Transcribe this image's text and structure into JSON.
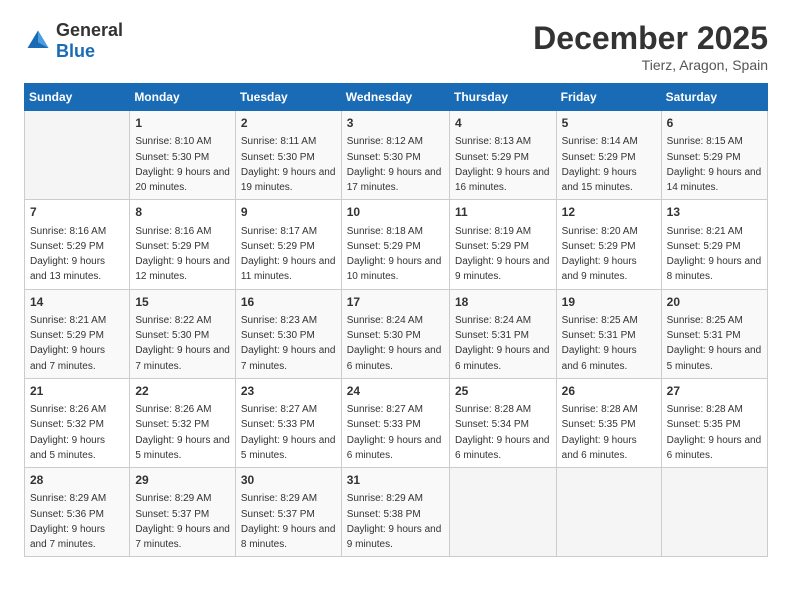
{
  "header": {
    "logo_general": "General",
    "logo_blue": "Blue",
    "month": "December 2025",
    "location": "Tierz, Aragon, Spain"
  },
  "weekdays": [
    "Sunday",
    "Monday",
    "Tuesday",
    "Wednesday",
    "Thursday",
    "Friday",
    "Saturday"
  ],
  "weeks": [
    [
      {
        "day": "",
        "sunrise": "",
        "sunset": "",
        "daylight": ""
      },
      {
        "day": "1",
        "sunrise": "Sunrise: 8:10 AM",
        "sunset": "Sunset: 5:30 PM",
        "daylight": "Daylight: 9 hours and 20 minutes."
      },
      {
        "day": "2",
        "sunrise": "Sunrise: 8:11 AM",
        "sunset": "Sunset: 5:30 PM",
        "daylight": "Daylight: 9 hours and 19 minutes."
      },
      {
        "day": "3",
        "sunrise": "Sunrise: 8:12 AM",
        "sunset": "Sunset: 5:30 PM",
        "daylight": "Daylight: 9 hours and 17 minutes."
      },
      {
        "day": "4",
        "sunrise": "Sunrise: 8:13 AM",
        "sunset": "Sunset: 5:29 PM",
        "daylight": "Daylight: 9 hours and 16 minutes."
      },
      {
        "day": "5",
        "sunrise": "Sunrise: 8:14 AM",
        "sunset": "Sunset: 5:29 PM",
        "daylight": "Daylight: 9 hours and 15 minutes."
      },
      {
        "day": "6",
        "sunrise": "Sunrise: 8:15 AM",
        "sunset": "Sunset: 5:29 PM",
        "daylight": "Daylight: 9 hours and 14 minutes."
      }
    ],
    [
      {
        "day": "7",
        "sunrise": "Sunrise: 8:16 AM",
        "sunset": "Sunset: 5:29 PM",
        "daylight": "Daylight: 9 hours and 13 minutes."
      },
      {
        "day": "8",
        "sunrise": "Sunrise: 8:16 AM",
        "sunset": "Sunset: 5:29 PM",
        "daylight": "Daylight: 9 hours and 12 minutes."
      },
      {
        "day": "9",
        "sunrise": "Sunrise: 8:17 AM",
        "sunset": "Sunset: 5:29 PM",
        "daylight": "Daylight: 9 hours and 11 minutes."
      },
      {
        "day": "10",
        "sunrise": "Sunrise: 8:18 AM",
        "sunset": "Sunset: 5:29 PM",
        "daylight": "Daylight: 9 hours and 10 minutes."
      },
      {
        "day": "11",
        "sunrise": "Sunrise: 8:19 AM",
        "sunset": "Sunset: 5:29 PM",
        "daylight": "Daylight: 9 hours and 9 minutes."
      },
      {
        "day": "12",
        "sunrise": "Sunrise: 8:20 AM",
        "sunset": "Sunset: 5:29 PM",
        "daylight": "Daylight: 9 hours and 9 minutes."
      },
      {
        "day": "13",
        "sunrise": "Sunrise: 8:21 AM",
        "sunset": "Sunset: 5:29 PM",
        "daylight": "Daylight: 9 hours and 8 minutes."
      }
    ],
    [
      {
        "day": "14",
        "sunrise": "Sunrise: 8:21 AM",
        "sunset": "Sunset: 5:29 PM",
        "daylight": "Daylight: 9 hours and 7 minutes."
      },
      {
        "day": "15",
        "sunrise": "Sunrise: 8:22 AM",
        "sunset": "Sunset: 5:30 PM",
        "daylight": "Daylight: 9 hours and 7 minutes."
      },
      {
        "day": "16",
        "sunrise": "Sunrise: 8:23 AM",
        "sunset": "Sunset: 5:30 PM",
        "daylight": "Daylight: 9 hours and 7 minutes."
      },
      {
        "day": "17",
        "sunrise": "Sunrise: 8:24 AM",
        "sunset": "Sunset: 5:30 PM",
        "daylight": "Daylight: 9 hours and 6 minutes."
      },
      {
        "day": "18",
        "sunrise": "Sunrise: 8:24 AM",
        "sunset": "Sunset: 5:31 PM",
        "daylight": "Daylight: 9 hours and 6 minutes."
      },
      {
        "day": "19",
        "sunrise": "Sunrise: 8:25 AM",
        "sunset": "Sunset: 5:31 PM",
        "daylight": "Daylight: 9 hours and 6 minutes."
      },
      {
        "day": "20",
        "sunrise": "Sunrise: 8:25 AM",
        "sunset": "Sunset: 5:31 PM",
        "daylight": "Daylight: 9 hours and 5 minutes."
      }
    ],
    [
      {
        "day": "21",
        "sunrise": "Sunrise: 8:26 AM",
        "sunset": "Sunset: 5:32 PM",
        "daylight": "Daylight: 9 hours and 5 minutes."
      },
      {
        "day": "22",
        "sunrise": "Sunrise: 8:26 AM",
        "sunset": "Sunset: 5:32 PM",
        "daylight": "Daylight: 9 hours and 5 minutes."
      },
      {
        "day": "23",
        "sunrise": "Sunrise: 8:27 AM",
        "sunset": "Sunset: 5:33 PM",
        "daylight": "Daylight: 9 hours and 5 minutes."
      },
      {
        "day": "24",
        "sunrise": "Sunrise: 8:27 AM",
        "sunset": "Sunset: 5:33 PM",
        "daylight": "Daylight: 9 hours and 6 minutes."
      },
      {
        "day": "25",
        "sunrise": "Sunrise: 8:28 AM",
        "sunset": "Sunset: 5:34 PM",
        "daylight": "Daylight: 9 hours and 6 minutes."
      },
      {
        "day": "26",
        "sunrise": "Sunrise: 8:28 AM",
        "sunset": "Sunset: 5:35 PM",
        "daylight": "Daylight: 9 hours and 6 minutes."
      },
      {
        "day": "27",
        "sunrise": "Sunrise: 8:28 AM",
        "sunset": "Sunset: 5:35 PM",
        "daylight": "Daylight: 9 hours and 6 minutes."
      }
    ],
    [
      {
        "day": "28",
        "sunrise": "Sunrise: 8:29 AM",
        "sunset": "Sunset: 5:36 PM",
        "daylight": "Daylight: 9 hours and 7 minutes."
      },
      {
        "day": "29",
        "sunrise": "Sunrise: 8:29 AM",
        "sunset": "Sunset: 5:37 PM",
        "daylight": "Daylight: 9 hours and 7 minutes."
      },
      {
        "day": "30",
        "sunrise": "Sunrise: 8:29 AM",
        "sunset": "Sunset: 5:37 PM",
        "daylight": "Daylight: 9 hours and 8 minutes."
      },
      {
        "day": "31",
        "sunrise": "Sunrise: 8:29 AM",
        "sunset": "Sunset: 5:38 PM",
        "daylight": "Daylight: 9 hours and 9 minutes."
      },
      {
        "day": "",
        "sunrise": "",
        "sunset": "",
        "daylight": ""
      },
      {
        "day": "",
        "sunrise": "",
        "sunset": "",
        "daylight": ""
      },
      {
        "day": "",
        "sunrise": "",
        "sunset": "",
        "daylight": ""
      }
    ]
  ]
}
